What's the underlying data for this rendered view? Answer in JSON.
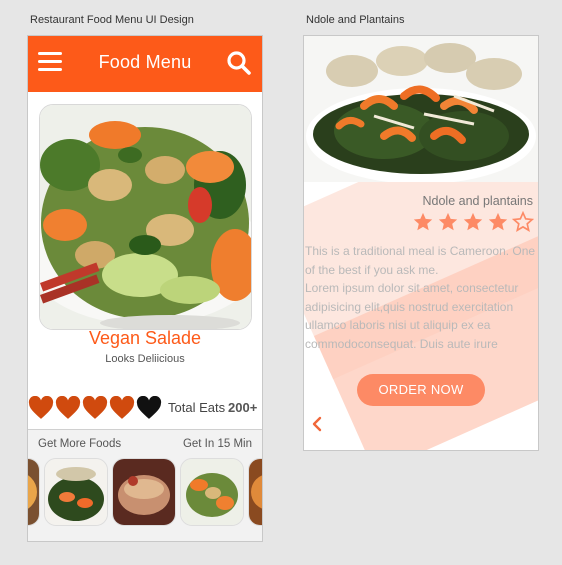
{
  "artboards": {
    "left_title": "Restaurant Food Menu UI Design",
    "right_title": "Ndole and Plantains"
  },
  "header": {
    "title": "Food Menu",
    "menu_icon": "hamburger-icon",
    "search_icon": "search-icon",
    "color": "#fd5a19"
  },
  "dish": {
    "name": "Vegan Salade",
    "subtitle": "Looks Deliicious",
    "eats_label": "Total Eats",
    "eats_count": "200+",
    "hearts_filled": 4,
    "hearts_total": 5
  },
  "more_foods": {
    "left_label": "Get More Foods",
    "right_label": "Get In 15 Min"
  },
  "detail": {
    "title": "Ndole and plantains",
    "rating": 4.5,
    "rating_max": 5,
    "body_line1": "This is a traditional meal is Cameroon. One of the best if you ask me.",
    "body_line2": "Lorem ipsum dolor sit amet, consectetur adipisicing elit,quis nostrud exercitation ullamco laboris nisi ut aliquip ex ea commodoconsequat. Duis aute irure",
    "order_label": "ORDER NOW",
    "back_icon": "chevron-left-icon",
    "accent": "#fd8a65"
  }
}
